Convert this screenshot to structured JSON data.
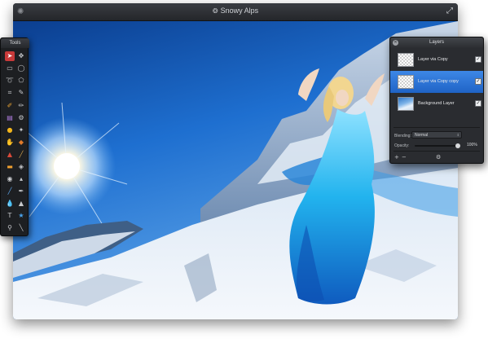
{
  "window": {
    "title": "Snowy Alps",
    "title_icon": "app-document-icon",
    "fullscreen_icon": "fullscreen-arrows-icon"
  },
  "colors": {
    "window_bg": "#1b1d20",
    "selection": "#2f74d6",
    "active_tool": "#c83a3a",
    "sky": "#1e6fd0",
    "snow": "#e8eef6",
    "dress": "#19a7e6"
  },
  "tools_panel": {
    "title": "Tools",
    "active_tool": "pointer",
    "tools": [
      "pointer",
      "move",
      "rect-select",
      "ellipse-select",
      "lasso",
      "polygon-lasso",
      "crop",
      "eyedropper",
      "brush",
      "pencil",
      "gradient",
      "clone-stamp",
      "paint-bucket",
      "magic-wand",
      "burn",
      "dodge",
      "smudge",
      "blur",
      "eraser",
      "red-eye",
      "eye",
      "sharpen",
      "line",
      "pen",
      "drop",
      "shape",
      "text",
      "star",
      "zoom",
      "hand"
    ]
  },
  "layers_panel": {
    "title": "Layers",
    "layers": [
      {
        "name": "Layer via Copy",
        "visible": true,
        "selected": false,
        "thumb": "transparent"
      },
      {
        "name": "Layer via Copy copy",
        "visible": true,
        "selected": true,
        "thumb": "transparent"
      },
      {
        "name": "Background Layer",
        "visible": true,
        "selected": false,
        "thumb": "photo"
      }
    ],
    "blending_label": "Blending:",
    "blending_value": "Normal",
    "opacity_label": "Opacity:",
    "opacity_value": "100%",
    "opacity_fraction": 1.0
  }
}
